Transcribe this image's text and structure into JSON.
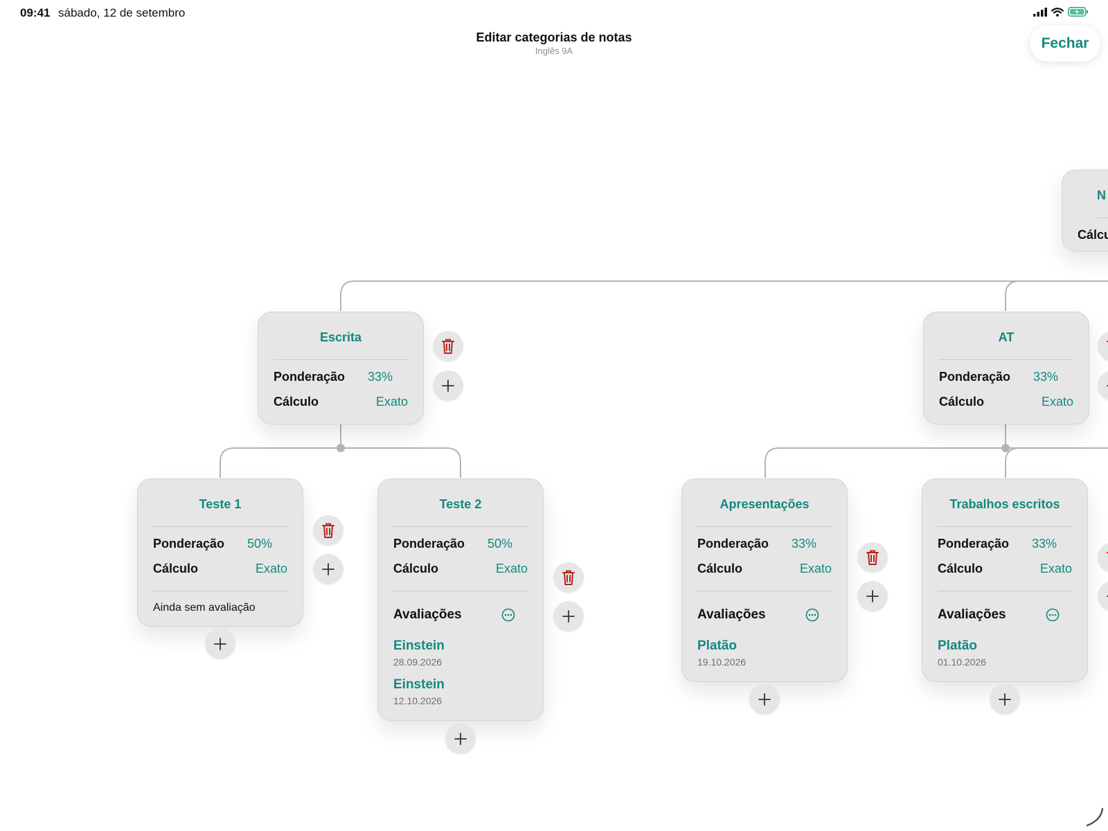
{
  "status_bar": {
    "time": "09:41",
    "date": "sábado, 12 de setembro"
  },
  "header": {
    "title": "Editar categorias de notas",
    "subtitle": "Inglês 9A",
    "close_label": "Fechar"
  },
  "labels": {
    "weight": "Ponderação",
    "calc": "Cálculo",
    "assessments": "Avaliações",
    "no_assessment": "Ainda sem avaliação"
  },
  "partial_root": {
    "title_fragment": "N",
    "calc_fragment": "Cálcu"
  },
  "categories": [
    {
      "title": "Escrita",
      "weight": "33%",
      "calc": "Exato"
    },
    {
      "title": "AT",
      "weight": "33%",
      "calc": "Exato"
    },
    {
      "title": "Teste 1",
      "weight": "50%",
      "calc": "Exato"
    },
    {
      "title": "Teste 2",
      "weight": "50%",
      "calc": "Exato",
      "assessments": [
        {
          "name": "Einstein",
          "date": "28.09.2026"
        },
        {
          "name": "Einstein",
          "date": "12.10.2026"
        }
      ]
    },
    {
      "title": "Apresentações",
      "weight": "33%",
      "calc": "Exato",
      "assessments": [
        {
          "name": "Platão",
          "date": "19.10.2026"
        }
      ]
    },
    {
      "title": "Trabalhos escritos",
      "weight": "33%",
      "calc": "Exato",
      "assessments": [
        {
          "name": "Platão",
          "date": "01.10.2026"
        }
      ]
    }
  ],
  "colors": {
    "accent": "#12897e",
    "delete": "#b3261e",
    "card": "#e6e6e6",
    "connector": "#b5b5b5"
  },
  "icons": [
    "trash-icon",
    "plus-icon",
    "more-icon",
    "signal-icon",
    "wifi-icon",
    "battery-icon"
  ]
}
